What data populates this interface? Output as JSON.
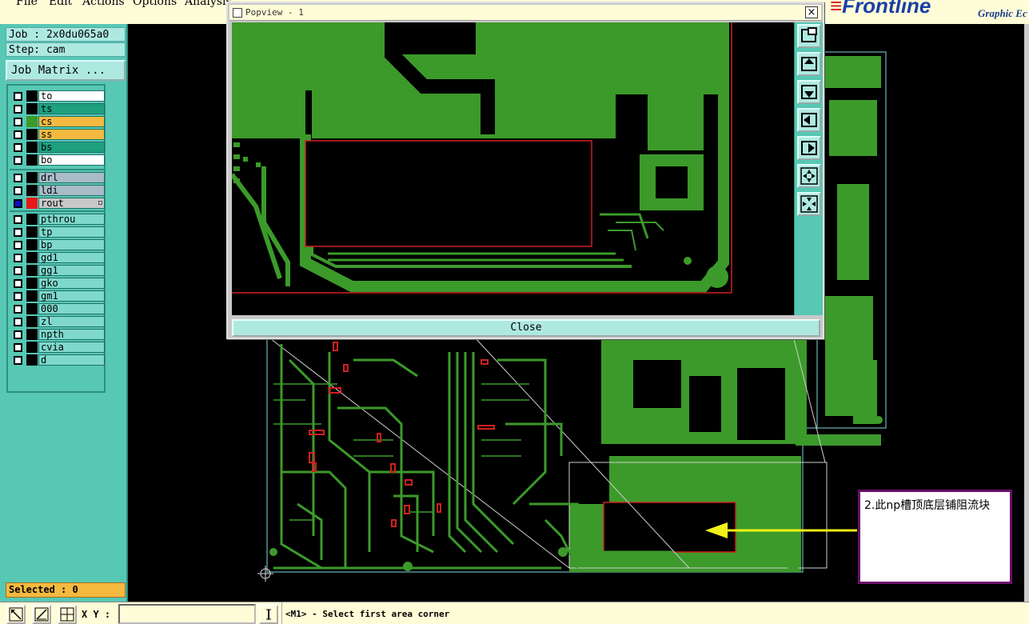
{
  "menu": {
    "items": [
      "File",
      "Edit",
      "Actions",
      "Options",
      "Analysis"
    ]
  },
  "branding": {
    "logo": "Frontline",
    "subtitle": "Graphic Ec"
  },
  "job": {
    "job_label": "Job : 2x0du065a0",
    "step_label": "Step: cam",
    "matrix_button": "Job Matrix ..."
  },
  "layers": {
    "board": [
      {
        "name": "to",
        "color": "#ffffff",
        "swatch": "#000000"
      },
      {
        "name": "ts",
        "color": "#1fa080",
        "swatch": "#000000"
      },
      {
        "name": "cs",
        "color": "#f5b93f",
        "swatch": "#3c9a2a"
      },
      {
        "name": "ss",
        "color": "#f5b93f",
        "swatch": "#000000"
      },
      {
        "name": "bs",
        "color": "#1fa080",
        "swatch": "#000000"
      },
      {
        "name": "bo",
        "color": "#ffffff",
        "swatch": "#000000"
      }
    ],
    "drill": [
      {
        "name": "drl",
        "color": "#a8bcc8",
        "swatch": "#000000"
      },
      {
        "name": "ldi",
        "color": "#a8bcc8",
        "swatch": "#000000"
      },
      {
        "name": "rout",
        "color": "#c8c8c8",
        "swatch": "#e81818",
        "checked": true
      }
    ],
    "misc": [
      {
        "name": "pthrou",
        "color": "#7fd8cc",
        "swatch": "#000000"
      },
      {
        "name": "tp",
        "color": "#7fd8cc",
        "swatch": "#000000"
      },
      {
        "name": "bp",
        "color": "#7fd8cc",
        "swatch": "#000000"
      },
      {
        "name": "gd1",
        "color": "#7fd8cc",
        "swatch": "#000000"
      },
      {
        "name": "gg1",
        "color": "#7fd8cc",
        "swatch": "#000000"
      },
      {
        "name": "gko",
        "color": "#7fd8cc",
        "swatch": "#000000"
      },
      {
        "name": "gm1",
        "color": "#7fd8cc",
        "swatch": "#000000"
      },
      {
        "name": "000",
        "color": "#7fd8cc",
        "swatch": "#000000"
      },
      {
        "name": "zl",
        "color": "#7fd8cc",
        "swatch": "#000000"
      },
      {
        "name": "npth",
        "color": "#7fd8cc",
        "swatch": "#000000"
      },
      {
        "name": "cvia",
        "color": "#7fd8cc",
        "swatch": "#000000"
      },
      {
        "name": "d",
        "color": "#7fd8cc",
        "swatch": "#000000"
      }
    ]
  },
  "selection": {
    "label": "Selected : 0"
  },
  "statusbar": {
    "xy_label": "X Y :",
    "xy_value": "",
    "prompt": "<M1> - Select first area corner"
  },
  "popview": {
    "title": "Popview - 1",
    "close_label": "Close",
    "close_x": "×"
  },
  "annotation": {
    "text": "2.此np槽顶底层铺阻流块"
  },
  "colors": {
    "copper": "#3c9a2a",
    "outline": "#7fd8e0",
    "rout": "#d02020",
    "arrow": "#f2f21a"
  }
}
